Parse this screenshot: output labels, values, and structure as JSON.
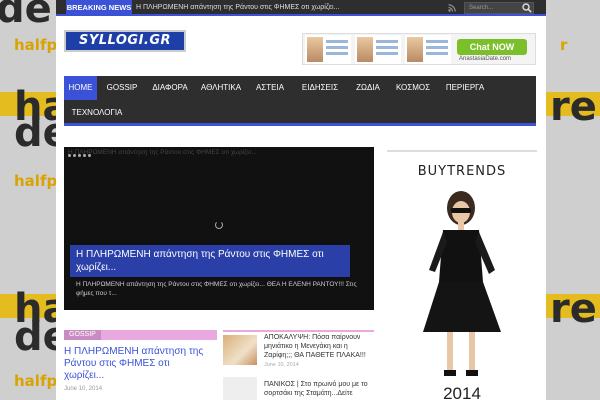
{
  "background": {
    "word_a": "de",
    "word_b": "ha",
    "word_c": "re",
    "small": "halfpr"
  },
  "topbar": {
    "breaking_label": "BREAKING NEWS",
    "ticker_text": "Η ΠΛΗΡΩΜΕΝΗ απάντηση της Ράντου στις ΦΗΜΕΣ οτι χωρίζει...",
    "search_placeholder": "Search..."
  },
  "logo": {
    "text": "SYLLOGI.GR"
  },
  "ad_banner": {
    "chat_label": "Chat NOW",
    "site": "AnastasiaDate.com"
  },
  "nav": {
    "items": [
      "HOME",
      "GOSSIP",
      "ΔΙΑΦΟΡΑ",
      "ΑΘΛΗΤΙΚΑ",
      "ΑΣΤΕΙΑ",
      "ΕΙΔΗΣΕΙΣ",
      "ΖΩΔΙΑ",
      "ΚΟΣΜΟΣ",
      "ΠΕΡΙΕΡΓΑ",
      "ΤΕΧΝΟΛΟΓΙΑ"
    ],
    "active": "HOME"
  },
  "slider": {
    "top_text": "Η ΠΛΗΡΩΜΕΝΗ απάντηση της Ράντου στις ΦΗΜΕΣ οτι χωρίζει...",
    "caption_title": "Η ΠΛΗΡΩΜΕΝΗ απάντηση της Ράντου στις ΦΗΜΕΣ οτι χωρίζει...",
    "caption_desc": "Η ΠΛΗΡΩΜΕΝΗ απάντηση της Ράντου στις ΦΗΜΕΣ οτι χωρίζει... ΘΕΑ Η ΕΛΕΝΗ ΡΑΝΤΟΥ!!! Στις φήμες που τ..."
  },
  "sidebar_ad": {
    "brand": "BUYTRENDS",
    "year": "2014"
  },
  "category": {
    "label": "GOSSIP"
  },
  "main_post": {
    "title": "Η ΠΛΗΡΩΜΕΝΗ απάντηση της Ράντου στις ΦΗΜΕΣ οτι χωρίζει...",
    "date": "June 10, 2014"
  },
  "side_posts": [
    {
      "title": "ΑΠΟΚΑΛΥΨΗ: Πόσα παίρνουν μηνιάτικο η Μενεγάκη και η Ζαρίφη;;; ΘΑ ΠΑΘΕΤΕ ΠΛΑΚΑ!!!",
      "date": "June 10, 2014"
    },
    {
      "title": "ΠΑΝΙΚΟΣ | Στο πρωινό μου με το σορτσάκι της Σταμάτη...Δείτε",
      "date": ""
    }
  ],
  "colors": {
    "accent": "#3b52d6",
    "topbar": "#2e2e2e",
    "gossip": "#c98cc2"
  }
}
